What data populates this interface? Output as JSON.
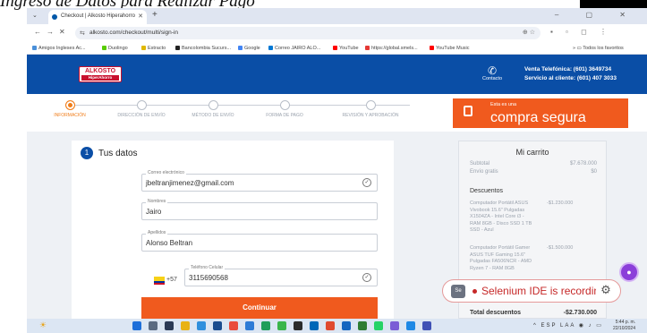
{
  "caption": "Ingreso de Datos para Realizar Pago",
  "browser": {
    "tab_title": "Checkout | Alkosto Hiperahorro",
    "url": "alkosto.com/checkout/multi/sign-in",
    "window_controls": "– ▢ ✕",
    "bookmarks": [
      "Amigos Ingleses Ac...",
      "Duolingo",
      "Estracto",
      "Bancolombia Sucurs...",
      "Google",
      "Correo JAIRO ALO...",
      "YouTube",
      "https://global.smels...",
      "YouTube Music"
    ],
    "all_bookmarks": "Todos los favoritos"
  },
  "header": {
    "logo_main": "ALKOSTO",
    "logo_sub": "HiperAhorro",
    "contact_label": "Contacto",
    "sales_line": "Venta Telefónica: (601) 3649734",
    "service_line": "Servicio al cliente: (601) 407 3033"
  },
  "steps": [
    {
      "label": "Información"
    },
    {
      "label": "Dirección de envío"
    },
    {
      "label": "Método de envío"
    },
    {
      "label": "Forma de pago"
    },
    {
      "label": "Revisión y aprobación"
    }
  ],
  "secure": {
    "small": "Esta es una",
    "big": "compra segura"
  },
  "form": {
    "step_number": "1",
    "title": "Tus datos",
    "email_label": "Correo electrónico",
    "email_value": "jbeltranjimenez@gmail.com",
    "name_label": "Nombres",
    "name_value": "Jairo",
    "surname_label": "Apellidos",
    "surname_value": "Alonso Beltran",
    "country_code": "+57",
    "phone_label": "Teléfono Celular",
    "phone_value": "3115690568",
    "continue_label": "Continuar"
  },
  "cart": {
    "title": "Mi carrito",
    "subtotal_label": "Subtotal",
    "subtotal_value": "$7.678.000",
    "shipping_label": "Envío gratis",
    "shipping_value": "$0",
    "discounts_label": "Descuentos",
    "items": [
      {
        "desc": "Computador Portátil ASUS Vivobook 15.6\" Pulgadas X1504ZA - Intel Core i3 - RAM 8GB - Disco SSD 1 TB SSD - Azul",
        "price": "-$1.230.000"
      },
      {
        "desc": "Computador Portátil Gamer ASUS TUF Gaming 15.6\" Pulgadas FA506NCR - AMD Ryzen 7 - RAM 8GB",
        "price": "-$1.500.000"
      }
    ],
    "total_label": "Total descuentos",
    "total_value": "-$2.730.000"
  },
  "selenium": {
    "text": "Selenium IDE is recording...",
    "icon_text": "Se"
  },
  "taskbar": {
    "lang": "ESP LAA",
    "time": "5:44 p. m.",
    "date": "22/10/2024"
  }
}
